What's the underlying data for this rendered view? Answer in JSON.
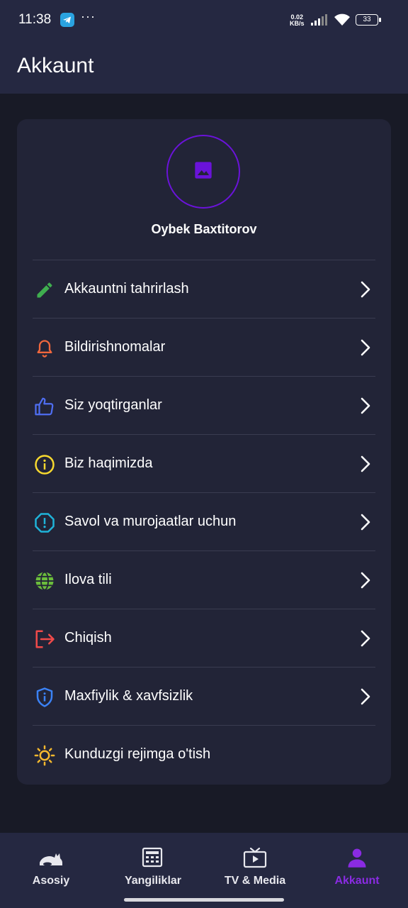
{
  "status_bar": {
    "time": "11:38",
    "more": "···",
    "net_speed_value": "0.02",
    "net_speed_unit": "KB/s",
    "battery": "33"
  },
  "header": {
    "title": "Akkaunt"
  },
  "profile": {
    "name": "Oybek Baxtitorov",
    "avatar_icon": "image-placeholder-icon",
    "accent": "#6a13d9"
  },
  "menu": [
    {
      "label": "Akkauntni tahrirlash",
      "icon": "pencil-icon",
      "color": "#3fae4f",
      "chevron": true
    },
    {
      "label": "Bildirishnomalar",
      "icon": "bell-icon",
      "color": "#f0673d",
      "chevron": true
    },
    {
      "label": "Siz yoqtirganlar",
      "icon": "thumbs-up-icon",
      "color": "#4f6ef2",
      "chevron": true
    },
    {
      "label": "Biz haqimizda",
      "icon": "info-icon",
      "color": "#f7d92f",
      "chevron": true
    },
    {
      "label": "Savol va murojaatlar uchun",
      "icon": "alert-octagon-icon",
      "color": "#1fb3d9",
      "chevron": true
    },
    {
      "label": "Ilova tili",
      "icon": "globe-icon",
      "color": "#6bbd3c",
      "chevron": true
    },
    {
      "label": "Chiqish",
      "icon": "logout-icon",
      "color": "#f04a4a",
      "chevron": true
    },
    {
      "label": "Maxfiylik & xavfsizlik",
      "icon": "shield-info-icon",
      "color": "#3b82f6",
      "chevron": true
    },
    {
      "label": "Kunduzgi rejimga o'tish",
      "icon": "sun-icon",
      "color": "#f5b82e",
      "chevron": false
    }
  ],
  "bottom_nav": [
    {
      "label": "Asosiy",
      "icon": "home-cat-icon",
      "active": false
    },
    {
      "label": "Yangiliklar",
      "icon": "newspaper-icon",
      "active": false
    },
    {
      "label": "TV & Media",
      "icon": "tv-play-icon",
      "active": false
    },
    {
      "label": "Akkaunt",
      "icon": "person-icon",
      "active": true
    }
  ]
}
